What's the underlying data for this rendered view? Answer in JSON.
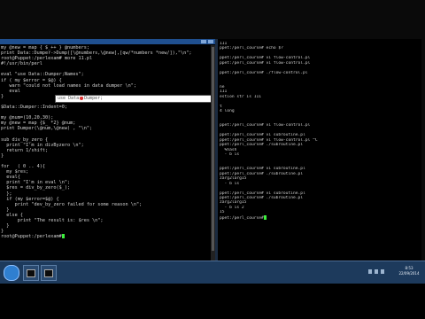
{
  "left_terminal": {
    "lines": [
      "my @new = map { $_++ } @numbers;",
      "print Data::Dumper->Dump([\\@numbers,\\@new],[qw/*numbers *new/]),\"\\n\";",
      "root@Puppet:/perlexam# more 11.pl",
      "#!/usr/bin/perl",
      "",
      "eval \"use Data::Dumper;Names\";",
      "if ( my $error = $@) {",
      "   warn \"could not load names in data dumper \\n\";",
      "   eval",
      "}",
      "",
      "$Data::Dumper::Indent=0;",
      "",
      "my @num=(10,20,30);",
      "my @new = map {$_ *2} @num;",
      "print Dumper(\\@num,\\@new) , \"\\n\";",
      "",
      "sub div_by_zero {",
      "  print \"I'm in divByzero \\n\";",
      "  return 1/shift;",
      "}",
      "",
      "for   ( 0 .. 4){",
      "  my $res;",
      "  eval{",
      "  print \"I'm in eval \\n\";",
      "  $res = div_by_zero($_);",
      "  };",
      "  if (my $error=$@) {",
      "     print \"dev_by_zero failed for some reason \\n\";",
      "  }",
      "  else {",
      "      print \"The result is: $res \\n\";",
      "  }",
      "}",
      "root@Puppet:/perlexam#"
    ],
    "popup_text": "use Data::Dumper;"
  },
  "right_terminal": {
    "lines": [
      "111",
      "ppet:/perl_course# echo $?",
      "",
      "ppet:/perl_course# vi flow-control.pl",
      "ppet:/perl_course# vi flow-control.pl",
      "",
      "ppet:/perl_course# ./flow-control.pl",
      "",
      "",
      "ne",
      "111",
      "estion str is 111",
      "",
      "t",
      "4 long",
      "",
      "",
      "ppet:/perl_course# vi flow-control.pl",
      "",
      "ppet:/perl_course# vi subroutine.pl",
      "ppet:/perl_course# vi flow-control.pl ^C",
      "ppet:/perl_course# ./subroutine.pl",
      "  %hash",
      "  - b is",
      "",
      "",
      "ppet:/perl_course# vi subroutine.pl",
      "ppet:/perl_course# ./subroutine.pl",
      "zarg2larg15",
      "  - b is",
      "",
      "ppet:/perl_course# vi subroutine.pl",
      "ppet:/perl_course# ./subroutine.pl",
      "zarg2larg15",
      "  - b is 2",
      "15",
      "ppet:/perl_course#"
    ]
  },
  "taskbar": {
    "clock_time": "8:53",
    "clock_date": "22/09/2014"
  },
  "icons": {
    "start": "windows-start-icon",
    "task1": "terminal-icon",
    "task2": "terminal-icon"
  },
  "colors": {
    "titlebar": "#1f4f8f",
    "taskbar": "#1d3a5c",
    "cursor": "#3cf03c"
  }
}
